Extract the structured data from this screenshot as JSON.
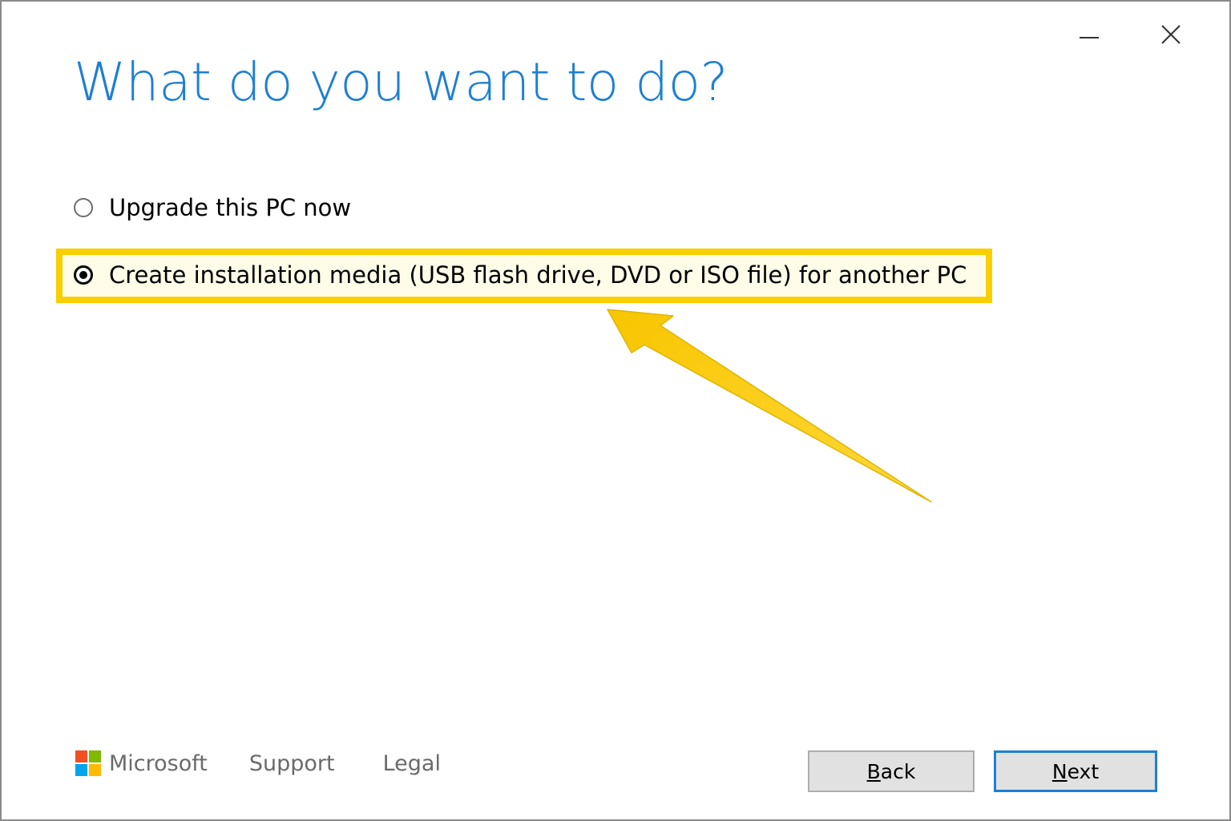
{
  "window": {
    "controls": {
      "minimize": "minimize-icon",
      "close": "close-icon"
    }
  },
  "heading": "What do you want to do?",
  "options": [
    {
      "label": "Upgrade this PC now",
      "selected": false
    },
    {
      "label": "Create installation media (USB flash drive, DVD or ISO file) for another PC",
      "selected": true
    }
  ],
  "footer": {
    "brand": "Microsoft",
    "links": [
      "Support",
      "Legal"
    ]
  },
  "buttons": {
    "back": {
      "accel": "B",
      "rest": "ack"
    },
    "next": {
      "accel": "N",
      "rest": "ext"
    }
  },
  "colors": {
    "accent": "#1e7fd2",
    "highlight": "#f9cf00",
    "logo": [
      "#f25022",
      "#7fba00",
      "#00a4ef",
      "#ffb900"
    ]
  }
}
